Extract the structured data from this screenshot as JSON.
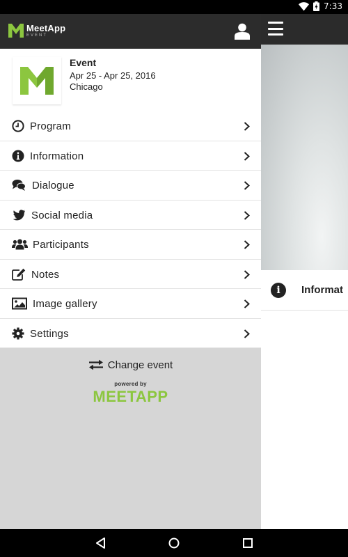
{
  "status_bar": {
    "time": "7:33"
  },
  "drawer": {
    "brand": {
      "name": "MeetApp",
      "sub": "EVENT"
    },
    "event": {
      "title": "Event",
      "dates": "Apr 25 - Apr 25, 2016",
      "location": "Chicago"
    },
    "menu": [
      {
        "label": "Program",
        "icon": "clock-icon"
      },
      {
        "label": "Information",
        "icon": "info-icon"
      },
      {
        "label": "Dialogue",
        "icon": "chat-bubbles-icon"
      },
      {
        "label": "Social media",
        "icon": "twitter-bird-icon"
      },
      {
        "label": "Participants",
        "icon": "people-icon"
      },
      {
        "label": "Notes",
        "icon": "edit-note-icon"
      },
      {
        "label": "Image gallery",
        "icon": "image-icon"
      },
      {
        "label": "Settings",
        "icon": "gear-icon"
      }
    ],
    "change_event": "Change event",
    "powered_by": "powered by",
    "powered_brand": "MEETAPP"
  },
  "main": {
    "info_label": "Informat"
  },
  "colors": {
    "brand_green": "#8cc63f",
    "header_dark": "#2c2c2c"
  }
}
